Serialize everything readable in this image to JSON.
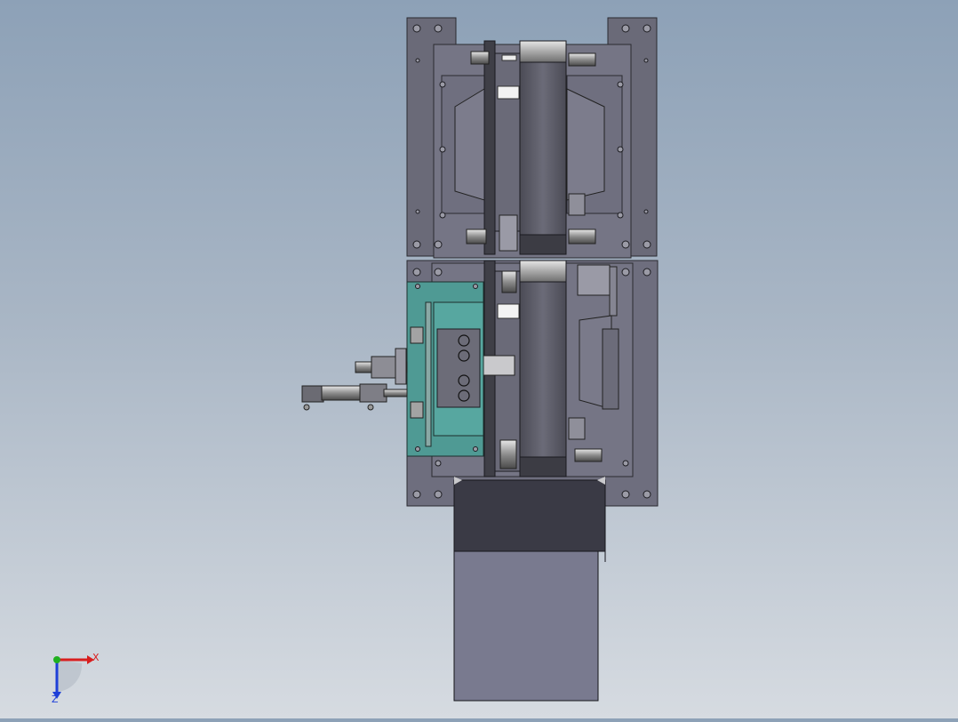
{
  "viewport": {
    "background_top": "#8da1b7",
    "background_bottom": "#d6dbe1"
  },
  "model": {
    "plate_color": "#6e6e7e",
    "plate_dark": "#5a5a68",
    "belt_color": "#55555f",
    "belt_light": "#c8c8c8",
    "teal_color": "#4f9a94",
    "hopper_dark": "#3a3a45",
    "hopper_light": "#797a8f"
  },
  "triad": {
    "x_label": "X",
    "z_label": "Z",
    "x_color": "#d81e1e",
    "y_color": "#1fb01f",
    "z_color": "#1e3fd8",
    "icons": [
      "axis-triad-icon"
    ]
  }
}
